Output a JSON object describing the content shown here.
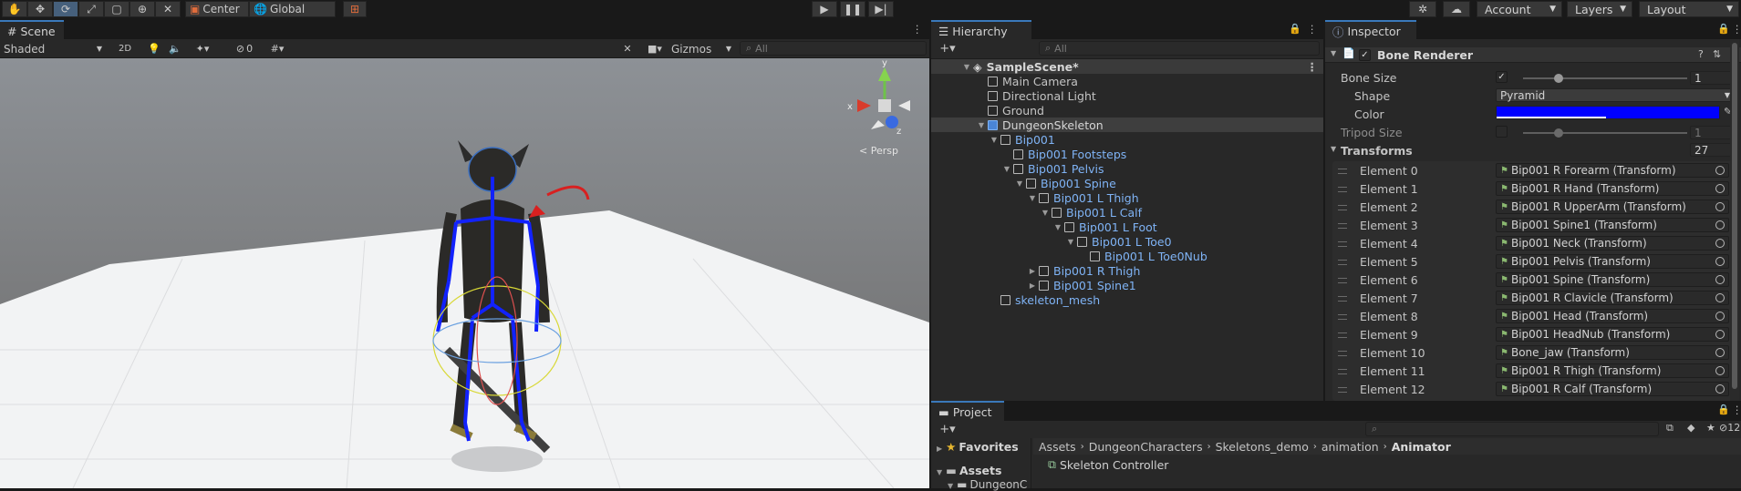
{
  "toolbar": {
    "pivot": "Center",
    "space": "Global",
    "account": "Account",
    "layers": "Layers",
    "layout": "Layout"
  },
  "scene": {
    "tab": "Scene",
    "shading": "Shaded",
    "mode2d": "2D",
    "hidden_count": "0",
    "gizmos": "Gizmos",
    "search_placeholder": "All",
    "persp": "< Persp",
    "axis_x": "x",
    "axis_y": "y",
    "axis_z": "z"
  },
  "hierarchy": {
    "tab": "Hierarchy",
    "search_placeholder": "All",
    "items": [
      {
        "label": "SampleScene*",
        "depth": 0
      },
      {
        "label": "Main Camera",
        "depth": 1
      },
      {
        "label": "Directional Light",
        "depth": 1
      },
      {
        "label": "Ground",
        "depth": 1
      },
      {
        "label": "DungeonSkeleton",
        "depth": 1
      },
      {
        "label": "Bip001",
        "depth": 2
      },
      {
        "label": "Bip001 Footsteps",
        "depth": 3
      },
      {
        "label": "Bip001 Pelvis",
        "depth": 3
      },
      {
        "label": "Bip001 Spine",
        "depth": 4
      },
      {
        "label": "Bip001 L Thigh",
        "depth": 5
      },
      {
        "label": "Bip001 L Calf",
        "depth": 6
      },
      {
        "label": "Bip001 L Foot",
        "depth": 7
      },
      {
        "label": "Bip001 L Toe0",
        "depth": 8
      },
      {
        "label": "Bip001 L Toe0Nub",
        "depth": 9
      },
      {
        "label": "Bip001 R Thigh",
        "depth": 5
      },
      {
        "label": "Bip001 Spine1",
        "depth": 5
      },
      {
        "label": "skeleton_mesh",
        "depth": 2
      }
    ]
  },
  "inspector": {
    "tab": "Inspector",
    "component": "Bone Renderer",
    "bone_size_label": "Bone Size",
    "bone_size_value": "1",
    "shape_label": "Shape",
    "shape_value": "Pyramid",
    "color_label": "Color",
    "color_value": "#0000ff",
    "tripod_label": "Tripod Size",
    "tripod_value": "1",
    "transforms_label": "Transforms",
    "transforms_count": "27",
    "elements": [
      {
        "label": "Element 0",
        "value": "Bip001 R Forearm (Transform)"
      },
      {
        "label": "Element 1",
        "value": "Bip001 R Hand (Transform)"
      },
      {
        "label": "Element 2",
        "value": "Bip001 R UpperArm (Transform)"
      },
      {
        "label": "Element 3",
        "value": "Bip001 Spine1 (Transform)"
      },
      {
        "label": "Element 4",
        "value": "Bip001 Neck (Transform)"
      },
      {
        "label": "Element 5",
        "value": "Bip001 Pelvis (Transform)"
      },
      {
        "label": "Element 6",
        "value": "Bip001 Spine (Transform)"
      },
      {
        "label": "Element 7",
        "value": "Bip001 R Clavicle (Transform)"
      },
      {
        "label": "Element 8",
        "value": "Bip001 Head (Transform)"
      },
      {
        "label": "Element 9",
        "value": "Bip001 HeadNub (Transform)"
      },
      {
        "label": "Element 10",
        "value": "Bone_jaw (Transform)"
      },
      {
        "label": "Element 11",
        "value": "Bip001 R Thigh (Transform)"
      },
      {
        "label": "Element 12",
        "value": "Bip001 R Calf (Transform)"
      }
    ]
  },
  "project": {
    "tab": "Project",
    "hidden_count": "12",
    "favorites": "Favorites",
    "assets": "Assets",
    "assets_child": "DungeonC",
    "breadcrumb": [
      "Assets",
      "DungeonCharacters",
      "Skeletons_demo",
      "animation",
      "Animator"
    ],
    "file": "Skeleton Controller"
  },
  "colors": {
    "accent": "#3a79bb",
    "selection_text": "#7fb3f5",
    "bone": "#0000ff"
  }
}
